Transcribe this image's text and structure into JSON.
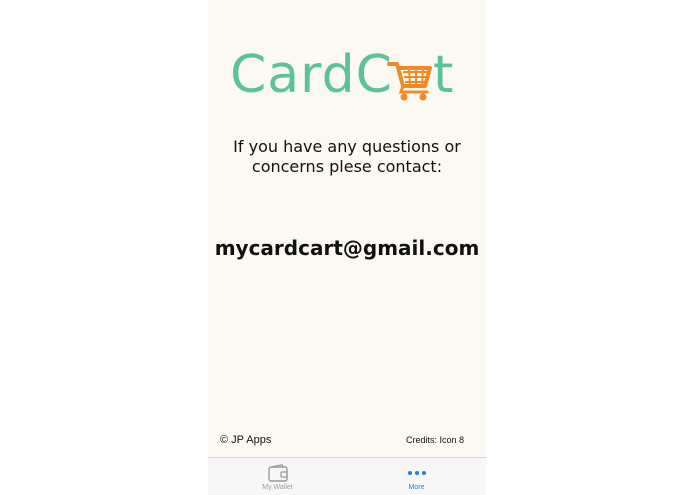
{
  "app": {
    "logo_prefix": "CardC",
    "logo_suffix": "t",
    "logo_color": "#5cc398",
    "cart_color": "#f08a24"
  },
  "main": {
    "contact_line1": "If you have any questions or",
    "contact_line2": "concerns plese contact:",
    "email": "mycardcart@gmail.com"
  },
  "footer": {
    "copyright": "© JP Apps",
    "credits": "Credits: Icon 8"
  },
  "tabs": [
    {
      "label": "My Wallet",
      "icon": "wallet-icon",
      "active": false
    },
    {
      "label": "More",
      "icon": "more-icon",
      "active": true
    }
  ],
  "colors": {
    "active_tab": "#1f7cf5",
    "inactive_tab": "#9a9a9a",
    "background": "#fbf9f2"
  }
}
